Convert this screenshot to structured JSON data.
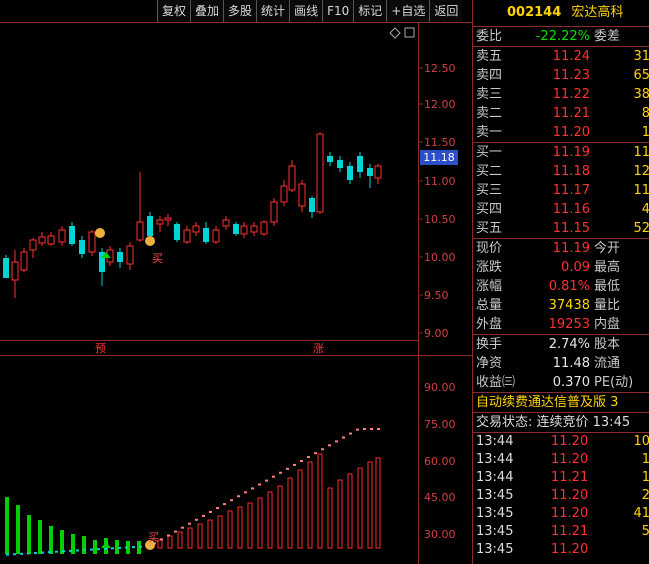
{
  "toolbar": [
    "复权",
    "叠加",
    "多股",
    "统计",
    "画线",
    "F10",
    "标记",
    "+自选",
    "返回"
  ],
  "price_axis": [
    "12.50",
    "12.00",
    "11.50",
    "11.00",
    "10.50",
    "10.00",
    "9.50",
    "9.00"
  ],
  "indicator_axis": [
    "90.00",
    "75.00",
    "60.00",
    "45.00",
    "30.00"
  ],
  "current_price_tag": "11.18",
  "markers": {
    "yu": "预",
    "zhang": "涨",
    "mai": "买"
  },
  "colors": {
    "up": "#ff3030",
    "down": "#00d4d4",
    "green_bar": "#00d000",
    "grid": "#8a2a2a"
  },
  "panel": {
    "code": "002144",
    "name": "宏达高科",
    "weibi_label": "委比",
    "weibi_value": "-22.22%",
    "weicha_label": "委差",
    "sell": [
      {
        "label": "卖五",
        "price": "11.24",
        "vol": "31"
      },
      {
        "label": "卖四",
        "price": "11.23",
        "vol": "65"
      },
      {
        "label": "卖三",
        "price": "11.22",
        "vol": "38"
      },
      {
        "label": "卖二",
        "price": "11.21",
        "vol": "8"
      },
      {
        "label": "卖一",
        "price": "11.20",
        "vol": "1"
      }
    ],
    "buy": [
      {
        "label": "买一",
        "price": "11.19",
        "vol": "11"
      },
      {
        "label": "买二",
        "price": "11.18",
        "vol": "12"
      },
      {
        "label": "买三",
        "price": "11.17",
        "vol": "11"
      },
      {
        "label": "买四",
        "price": "11.16",
        "vol": "4"
      },
      {
        "label": "买五",
        "price": "11.15",
        "vol": "52"
      }
    ],
    "stats": [
      {
        "l1": "现价",
        "v": "11.19",
        "c": "red",
        "l2": "今开"
      },
      {
        "l1": "涨跌",
        "v": "0.09",
        "c": "red",
        "l2": "最高"
      },
      {
        "l1": "涨幅",
        "v": "0.81%",
        "c": "red",
        "l2": "最低"
      },
      {
        "l1": "总量",
        "v": "37438",
        "c": "yellow",
        "l2": "量比"
      },
      {
        "l1": "外盘",
        "v": "19253",
        "c": "red",
        "l2": "内盘"
      }
    ],
    "stats2": [
      {
        "l1": "换手",
        "v": "2.74%",
        "c": "white",
        "l2": "股本"
      },
      {
        "l1": "净资",
        "v": "11.48",
        "c": "white",
        "l2": "流通"
      },
      {
        "l1": "收益㈢",
        "v": "0.370",
        "c": "white",
        "l2": "PE(动)"
      }
    ],
    "ad": "自动续费通达信普及版  3",
    "trade_status": "交易状态: 连续竞价 13:45",
    "ticks": [
      {
        "t": "13:44",
        "p": "11.20",
        "q": "10"
      },
      {
        "t": "13:44",
        "p": "11.20",
        "q": "1"
      },
      {
        "t": "13:44",
        "p": "11.21",
        "q": "1"
      },
      {
        "t": "13:45",
        "p": "11.20",
        "q": "2"
      },
      {
        "t": "13:45",
        "p": "11.20",
        "q": "41"
      },
      {
        "t": "13:45",
        "p": "11.21",
        "q": "5"
      },
      {
        "t": "13:45",
        "p": "11.20",
        "q": ""
      }
    ]
  }
}
